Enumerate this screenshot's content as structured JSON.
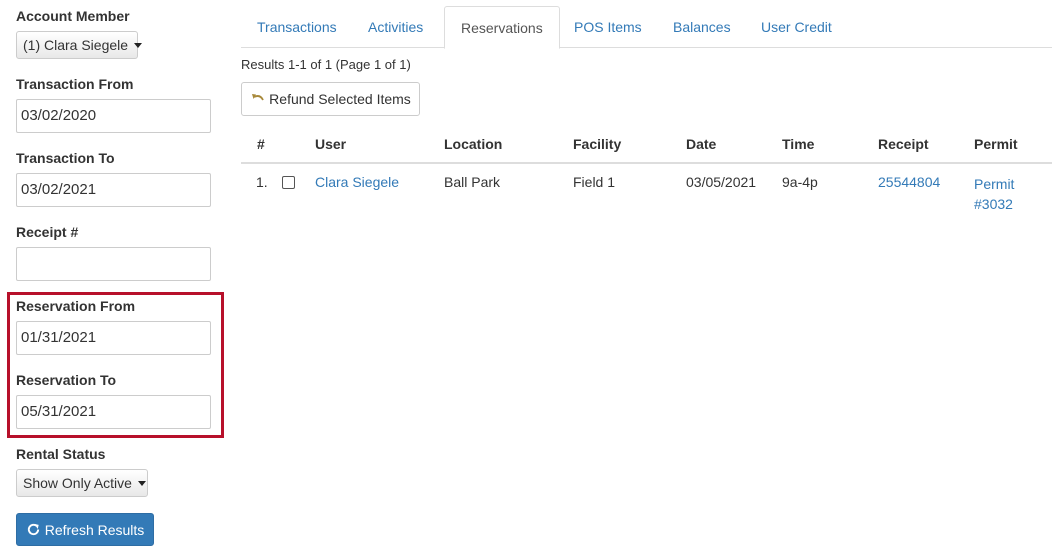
{
  "filters": {
    "account_member": {
      "label": "Account Member",
      "value": "(1) Clara Siegele"
    },
    "transaction_from": {
      "label": "Transaction From",
      "value": "03/02/2020"
    },
    "transaction_to": {
      "label": "Transaction To",
      "value": "03/02/2021"
    },
    "receipt": {
      "label": "Receipt #",
      "value": ""
    },
    "reservation_from": {
      "label": "Reservation From",
      "value": "01/31/2021"
    },
    "reservation_to": {
      "label": "Reservation To",
      "value": "05/31/2021"
    },
    "rental_status": {
      "label": "Rental Status",
      "value": "Show Only Active"
    },
    "refresh_label": "Refresh Results",
    "highlight_color": "#b7102a"
  },
  "tabs": [
    {
      "label": "Transactions"
    },
    {
      "label": "Activities"
    },
    {
      "label": "Reservations",
      "active": true
    },
    {
      "label": "POS Items"
    },
    {
      "label": "Balances"
    },
    {
      "label": "User Credit"
    }
  ],
  "results_text": "Results 1-1 of 1 (Page 1 of 1)",
  "refund_label": "Refund Selected Items",
  "table": {
    "headers": [
      "#",
      "User",
      "Location",
      "Facility",
      "Date",
      "Time",
      "Receipt",
      "Permit"
    ],
    "rows": [
      {
        "num": "1.",
        "user": "Clara Siegele",
        "location": "Ball Park",
        "facility": "Field 1",
        "date": "03/05/2021",
        "time": "9a-4p",
        "receipt": "25544804",
        "permit_line1": "Permit",
        "permit_line2": "#3032"
      }
    ]
  },
  "colors": {
    "link": "#337ab7",
    "primary_button": "#337ab7"
  }
}
